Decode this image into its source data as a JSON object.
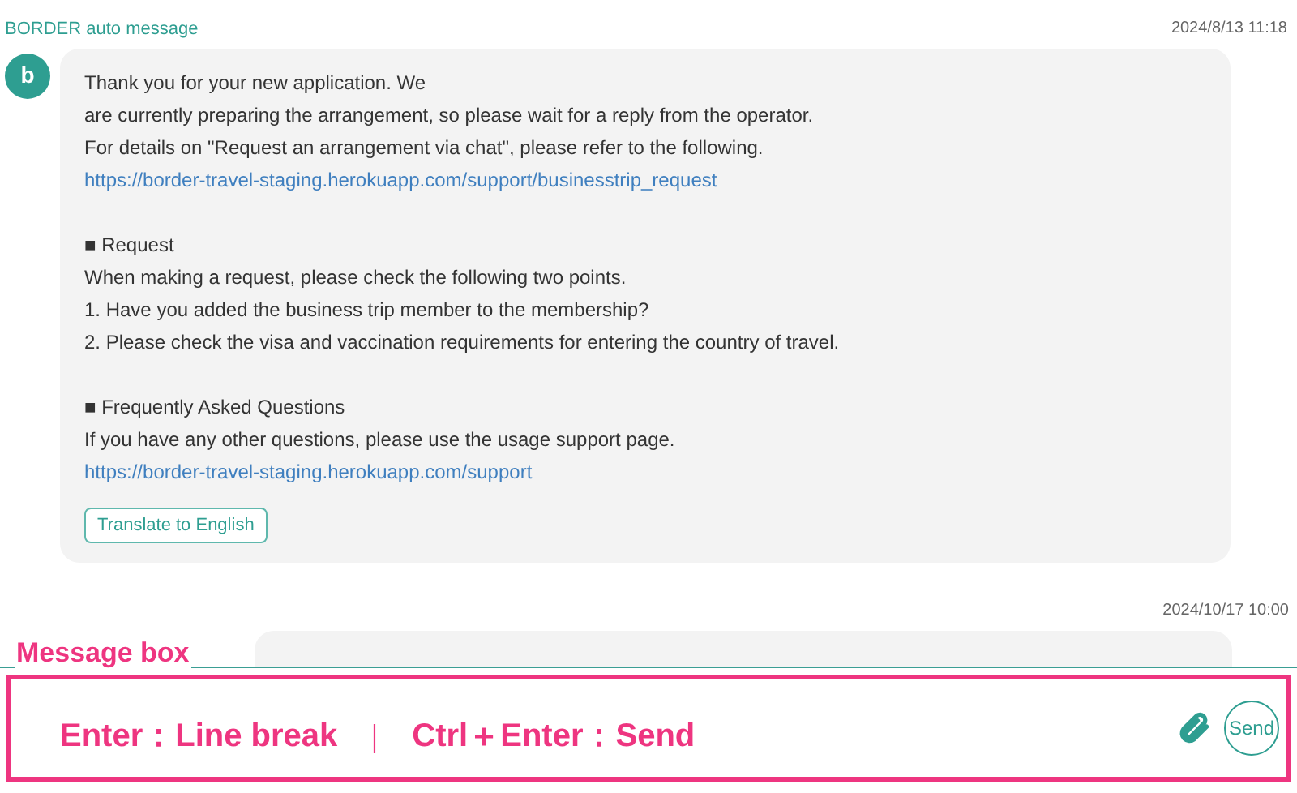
{
  "messages": [
    {
      "sender": "BORDER auto message",
      "time": "2024/8/13 11:18",
      "avatar": "b",
      "lines": [
        {
          "kind": "text",
          "text": "Thank you for your new application. We"
        },
        {
          "kind": "text",
          "text": "are currently preparing the arrangement, so please wait for a reply from the operator."
        },
        {
          "kind": "text",
          "text": "For details on \"Request an arrangement via chat\", please refer to the following."
        },
        {
          "kind": "link",
          "text": "https://border-travel-staging.herokuapp.com/support/businesstrip_request"
        },
        {
          "kind": "gap"
        },
        {
          "kind": "text",
          "text": "■ Request"
        },
        {
          "kind": "text",
          "text": "When making a request, please check the following two points."
        },
        {
          "kind": "text",
          "text": "1. Have you added the business trip member to the membership?"
        },
        {
          "kind": "text",
          "text": "2. Please check the visa and vaccination requirements for entering the country of travel."
        },
        {
          "kind": "gap"
        },
        {
          "kind": "text",
          "text": "■ Frequently Asked Questions"
        },
        {
          "kind": "text",
          "text": "If you have any other questions, please use the usage support page."
        },
        {
          "kind": "link",
          "text": "https://border-travel-staging.herokuapp.com/support"
        }
      ],
      "translate_button": "Translate to English"
    },
    {
      "time": "2024/10/17 10:00"
    }
  ],
  "annotation": {
    "label": "Message box",
    "hint_parts": [
      "Enter：Line break",
      "｜",
      "Ctrl＋Enter：Send"
    ]
  },
  "send_button": "Send"
}
